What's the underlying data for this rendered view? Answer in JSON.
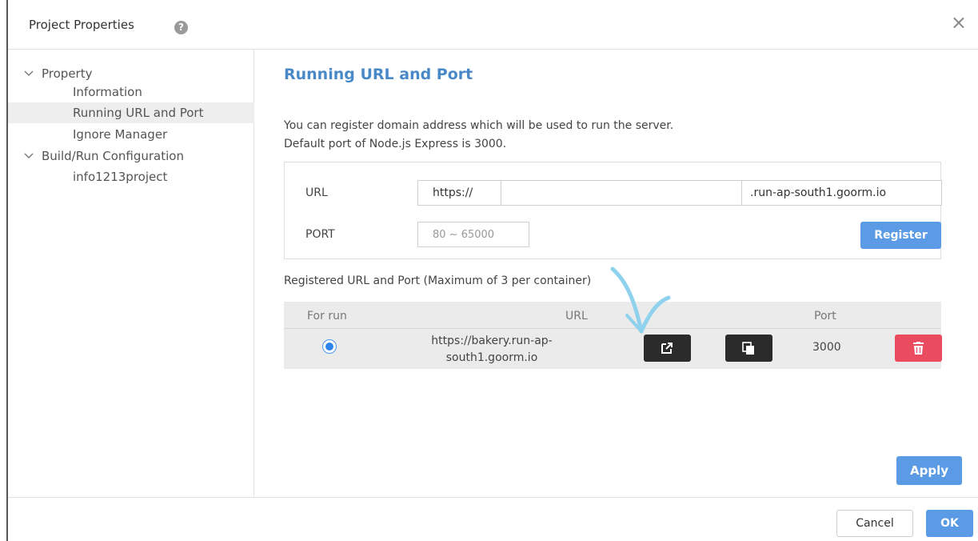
{
  "dialog": {
    "title": "Project Properties",
    "help_icon": "?",
    "close_icon": "×"
  },
  "sidebar": {
    "items": [
      {
        "label": "Property",
        "level": 0,
        "expanded": true
      },
      {
        "label": "Information",
        "level": 1
      },
      {
        "label": "Running URL and Port",
        "level": 1,
        "selected": true
      },
      {
        "label": "Ignore Manager",
        "level": 1
      },
      {
        "label": "Build/Run Configuration",
        "level": 0,
        "expanded": true
      },
      {
        "label": "info1213project",
        "level": 1
      }
    ]
  },
  "main": {
    "title": "Running URL and Port",
    "description_line1": "You can register domain address which will be used to run the server.",
    "description_line2": "Default port of Node.js Express is 3000.",
    "form": {
      "url_label": "URL",
      "url_prefix": "https://",
      "url_value": "",
      "url_suffix": ".run-ap-south1.goorm.io",
      "port_label": "PORT",
      "port_placeholder": "80 ~ 65000",
      "register_label": "Register"
    },
    "registered_title": "Registered URL and Port (Maximum of 3 per container)",
    "table": {
      "headers": {
        "for_run": "For run",
        "url": "URL",
        "port": "Port"
      },
      "rows": [
        {
          "url_line1": "https://bakery.run-ap-",
          "url_line2": "south1.goorm.io",
          "port": "3000",
          "selected": true
        }
      ]
    },
    "apply_label": "Apply"
  },
  "footer": {
    "cancel_label": "Cancel",
    "ok_label": "OK"
  },
  "colors": {
    "accent": "#4a89c8",
    "primary_button": "#5b9be6",
    "delete_button": "#ea4b5e",
    "dark_button": "#2b2b2b",
    "annotation": "#8fd2ee"
  }
}
